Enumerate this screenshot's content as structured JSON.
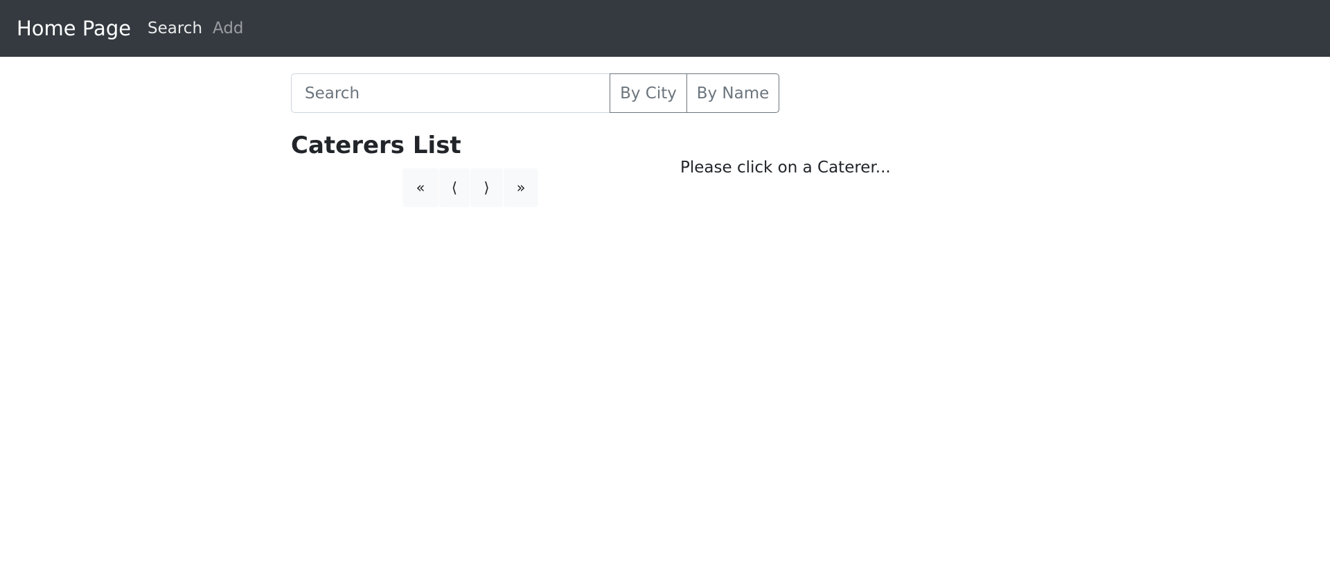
{
  "navbar": {
    "brand": "Home Page",
    "links": [
      {
        "label": "Search"
      },
      {
        "label": "Add"
      }
    ]
  },
  "search": {
    "placeholder": "Search",
    "value": "",
    "buttons": [
      {
        "label": "By City"
      },
      {
        "label": "By Name"
      }
    ]
  },
  "list": {
    "title": "Caterers List",
    "pagination": {
      "first": "«",
      "prev": "⟨",
      "next": "⟩",
      "last": "»"
    }
  },
  "details": {
    "hint": "Please click on a Caterer..."
  },
  "colors": {
    "navbar_bg": "#343a40",
    "button_border": "#6c757d",
    "pager_bg": "#f8f9fa"
  }
}
